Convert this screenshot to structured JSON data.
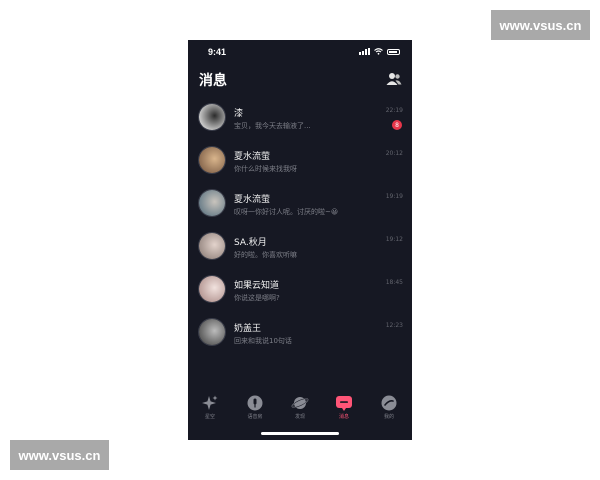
{
  "watermarks": {
    "top": "www.vsus.cn",
    "bottom": "www.vsus.cn"
  },
  "status_bar": {
    "time": "9:41"
  },
  "header": {
    "title": "消息",
    "icon": "contacts-icon"
  },
  "conversations": [
    {
      "name": "漆",
      "preview": "宝贝，我今天去输液了...",
      "time": "22:19",
      "unread": "8",
      "avatar_colors": [
        "#cfcfcf",
        "#2b2b2b"
      ]
    },
    {
      "name": "夏水流萤",
      "preview": "你什么时候来找我呀",
      "time": "20:12",
      "unread": null,
      "avatar_colors": [
        "#8a6a50",
        "#d9b58c"
      ]
    },
    {
      "name": "夏水流萤",
      "preview": "叹呀一你好讨人呢。讨厌的啦~😀",
      "time": "19:19",
      "unread": null,
      "avatar_colors": [
        "#6c7f8a",
        "#c9c4bd"
      ]
    },
    {
      "name": "SA.秋月",
      "preview": "好的啦。你喜欢听嘛",
      "time": "19:12",
      "unread": null,
      "avatar_colors": [
        "#9b8c86",
        "#e3d3cc"
      ]
    },
    {
      "name": "如果云知道",
      "preview": "你说这是哪啊?",
      "time": "18:45",
      "unread": null,
      "avatar_colors": [
        "#b79a96",
        "#f1e2de"
      ]
    },
    {
      "name": "奶盖王",
      "preview": "回来和我说10句话",
      "time": "12:23",
      "unread": null,
      "avatar_colors": [
        "#5a5a5a",
        "#bcbcbc"
      ]
    }
  ],
  "tabs": [
    {
      "label": "星空",
      "icon": "sparkle-icon",
      "active": false
    },
    {
      "label": "语音房",
      "icon": "voice-room-icon",
      "active": false
    },
    {
      "label": "发现",
      "icon": "planet-icon",
      "active": false
    },
    {
      "label": "消息",
      "icon": "message-icon",
      "active": true
    },
    {
      "label": "我的",
      "icon": "profile-icon",
      "active": false
    }
  ],
  "colors": {
    "background": "#161823",
    "accent": "#ff5577",
    "badge": "#e8364a"
  }
}
